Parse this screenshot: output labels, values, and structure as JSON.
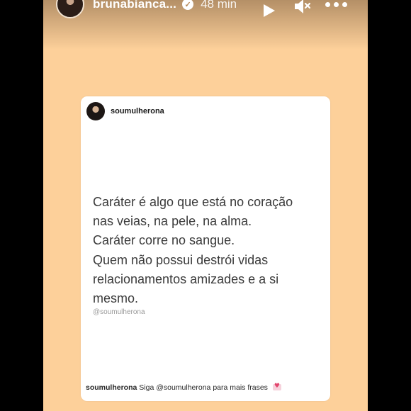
{
  "story": {
    "username": "brunabianca...",
    "time": "48 min"
  },
  "post": {
    "username": "soumulherona",
    "quote_lines": [
      "Caráter é algo que está no coração",
      "nas veias, na pele, na alma.",
      "Caráter corre no sangue.",
      "Quem não possui destrói vidas",
      "relacionamentos amizades e a si",
      "mesmo."
    ],
    "handle": "@soumulherona",
    "caption_user": "soumulherona",
    "caption_text": "Siga @soumulherona para mais frases"
  },
  "colors": {
    "story_background": "#fdd09a",
    "card_background": "#ffffff"
  },
  "icons": [
    "avatar",
    "verified-icon",
    "play-icon",
    "mute-icon",
    "more-icon",
    "heart-icon"
  ]
}
